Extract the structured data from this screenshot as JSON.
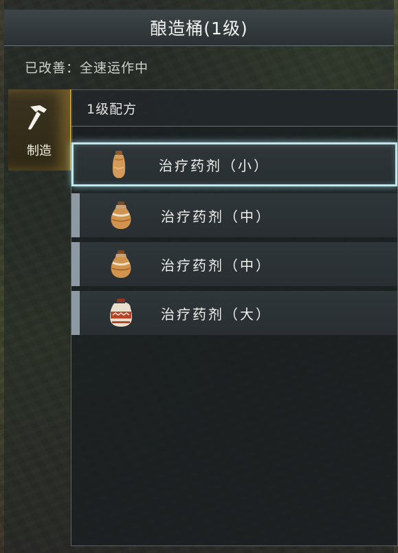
{
  "window": {
    "title": "酿造桶(1级)",
    "status": "已改善：全速运作中"
  },
  "tab": {
    "label": "制造",
    "icon": "hammer-icon"
  },
  "panel": {
    "header": "1级配方",
    "recipes": [
      {
        "label": "治疗药剂（小）",
        "icon": "small-potion-icon",
        "selected": true
      },
      {
        "label": "治疗药剂（中）",
        "icon": "medium-potion-icon",
        "selected": false
      },
      {
        "label": "治疗药剂（中）",
        "icon": "medium-potion-icon",
        "selected": false
      },
      {
        "label": "治疗药剂（大）",
        "icon": "large-potion-icon",
        "selected": false
      }
    ]
  },
  "colors": {
    "accent_tab": "#e0b640",
    "selection_glow": "#bfe6ea",
    "item_marker": "#8d99a3"
  }
}
